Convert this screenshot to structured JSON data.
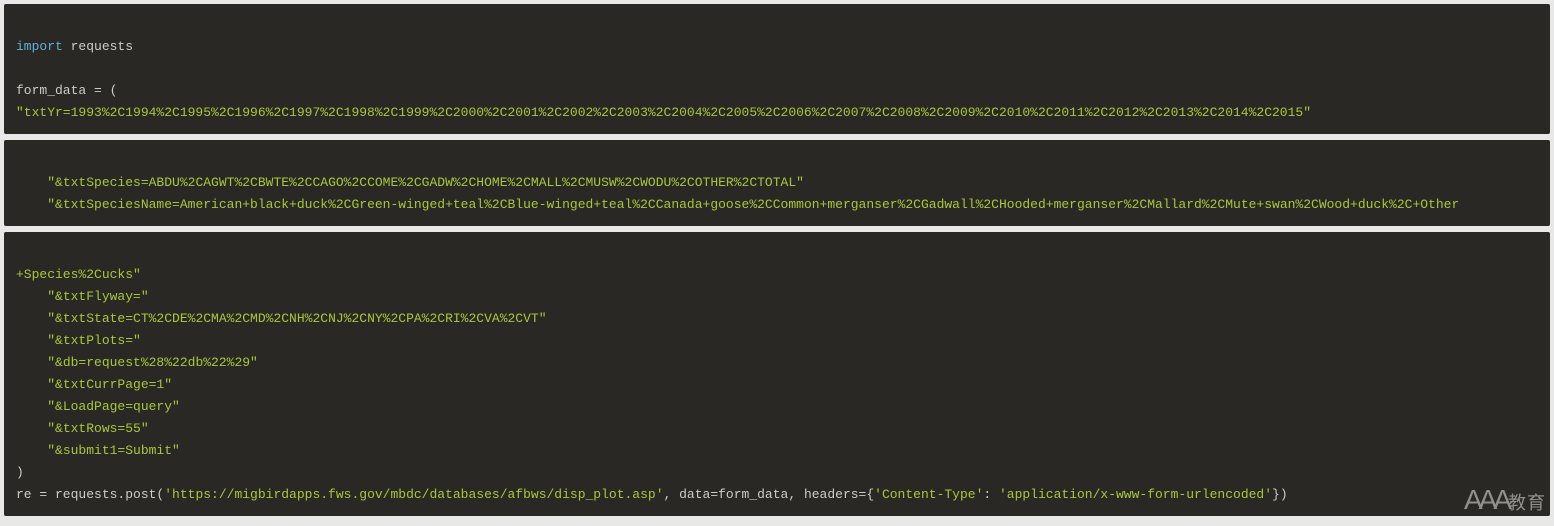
{
  "block1": {
    "line1": {
      "import_kw": "import",
      "module": " requests"
    },
    "line2": "",
    "line3": {
      "prefix": "form_data = ",
      "paren": "("
    },
    "line4": {
      "string": "\"txtYr=1993%2C1994%2C1995%2C1996%2C1997%2C1998%2C1999%2C2000%2C2001%2C2002%2C2003%2C2004%2C2005%2C2006%2C2007%2C2008%2C2009%2C2010%2C2011%2C2012%2C2013%2C2014%2C2015\""
    }
  },
  "block2": {
    "line1": {
      "string": "\"&txtSpecies=ABDU%2CAGWT%2CBWTE%2CCAGO%2CCOME%2CGADW%2CHOME%2CMALL%2CMUSW%2CWODU%2COTHER%2CTOTAL\""
    },
    "line2": {
      "string": "\"&txtSpeciesName=American+black+duck%2CGreen-winged+teal%2CBlue-winged+teal%2CCanada+goose%2CCommon+merganser%2CGadwall%2CHooded+merganser%2CMallard%2CMute+swan%2CWood+duck%2C+Other"
    }
  },
  "block3": {
    "line1": {
      "string": "+Species%2Cucks\""
    },
    "line2": {
      "string": "\"&txtFlyway=\""
    },
    "line3": {
      "string": "\"&txtState=CT%2CDE%2CMA%2CMD%2CNH%2CNJ%2CNY%2CPA%2CRI%2CVA%2CVT\""
    },
    "line4": {
      "string": "\"&txtPlots=\""
    },
    "line5": {
      "string": "\"&db=request%28%22db%22%29\""
    },
    "line6": {
      "string": "\"&txtCurrPage=1\""
    },
    "line7": {
      "string": "\"&LoadPage=query\""
    },
    "line8": {
      "string": "\"&txtRows=55\""
    },
    "line9": {
      "string": "\"&submit1=Submit\""
    },
    "line10": {
      "paren": ")"
    },
    "line11": {
      "prefix": "re = requests.post(",
      "url": "'https://migbirdapps.fws.gov/mbdc/databases/afbws/disp_plot.asp'",
      "mid1": ", data=form_data, headers={",
      "key": "'Content-Type'",
      "colon": ": ",
      "val": "'application/x-www-form-urlencoded'",
      "suffix": "})"
    }
  },
  "watermark": {
    "aaa": "AAA",
    "label": "教育"
  }
}
